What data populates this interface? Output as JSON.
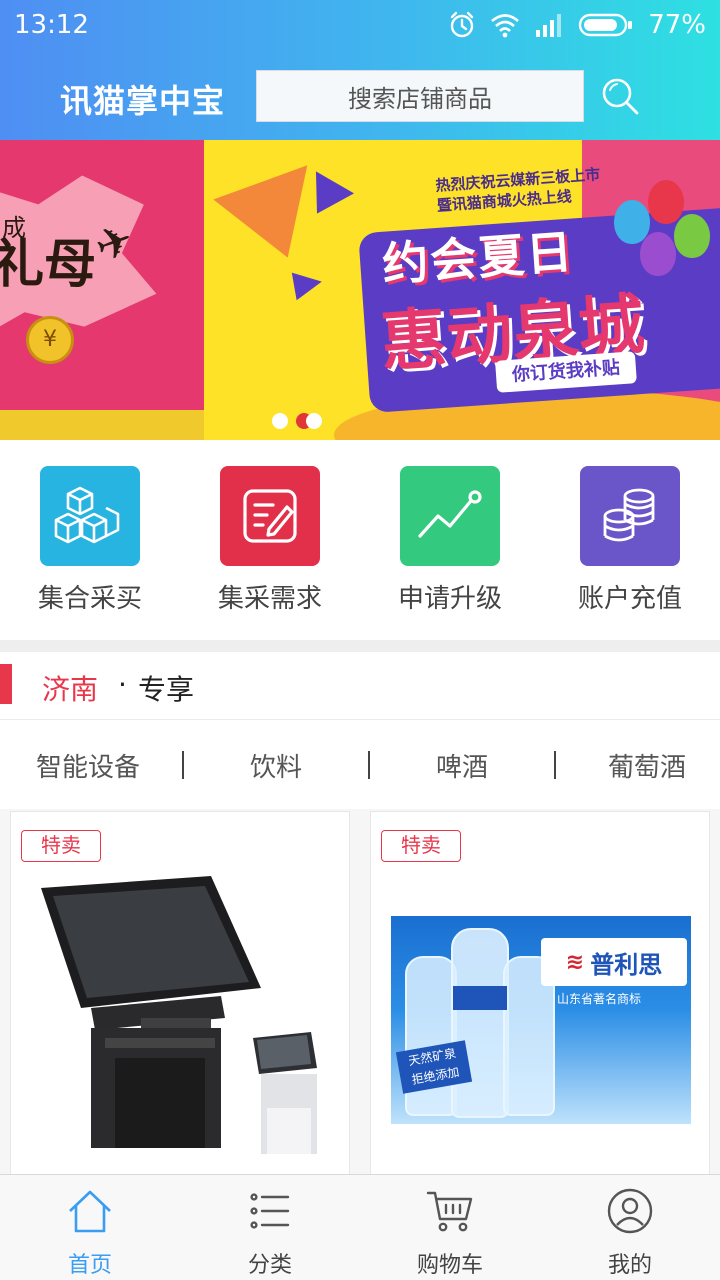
{
  "status_bar": {
    "time": "13:12",
    "battery": "77%",
    "icons": [
      "alarm-icon",
      "wifi-icon",
      "signal-icon",
      "battery-icon"
    ]
  },
  "header": {
    "app_title": "讯猫掌中宝",
    "search_placeholder": "搜索店铺商品",
    "search_icon": "search-icon"
  },
  "banner": {
    "left_slide": {
      "big_text": "礼母",
      "small_text": "成",
      "coin": "¥"
    },
    "main_slide": {
      "announcement_line1": "热烈庆祝云媒新三板上市",
      "announcement_line2": "暨讯猫商城火热上线",
      "headline_line1": "约会夏日",
      "headline_line2": "惠动泉城",
      "slogan": "你订货我补贴"
    },
    "page_count": 3,
    "active_index": 1
  },
  "quick_actions": [
    {
      "label": "集合采买",
      "icon": "boxes-icon",
      "color": "#27b4e0"
    },
    {
      "label": "集采需求",
      "icon": "edit-form-icon",
      "color": "#e2304a"
    },
    {
      "label": "申请升级",
      "icon": "trend-up-icon",
      "color": "#33c97e"
    },
    {
      "label": "账户充值",
      "icon": "coins-icon",
      "color": "#6a55c9"
    }
  ],
  "section": {
    "city": "济南",
    "separator": "·",
    "title": "专享"
  },
  "categories": [
    "智能设备",
    "饮料",
    "啤酒",
    "葡萄酒"
  ],
  "products": [
    {
      "tag": "特卖",
      "image": "pos-terminal-image"
    },
    {
      "tag": "特卖",
      "image": "mineral-water-image",
      "brand": "普利思",
      "brand_sub": "山东省著名商标",
      "badge_line1": "天然矿泉",
      "badge_line2": "拒绝添加"
    }
  ],
  "tab_bar": [
    {
      "label": "首页",
      "icon": "home-icon",
      "active": true
    },
    {
      "label": "分类",
      "icon": "list-icon",
      "active": false
    },
    {
      "label": "购物车",
      "icon": "cart-icon",
      "active": false
    },
    {
      "label": "我的",
      "icon": "user-icon",
      "active": false
    }
  ],
  "colors": {
    "accent_red": "#e8374a",
    "accent_blue": "#3a9cf2",
    "header_gradient_start": "#4f8ef3",
    "header_gradient_end": "#2ee0e2"
  }
}
